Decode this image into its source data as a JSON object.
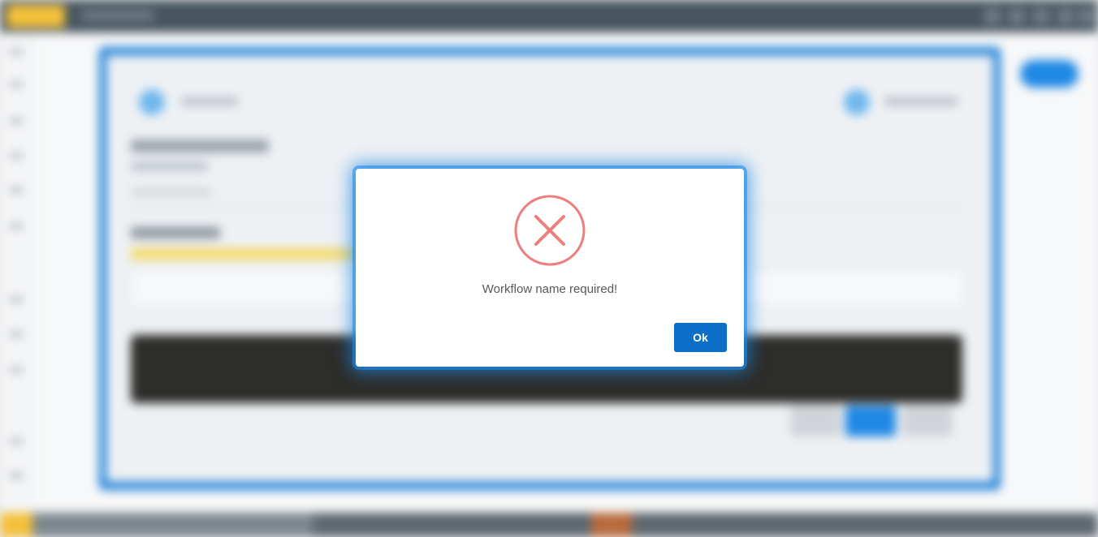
{
  "dialog": {
    "message": "Workflow name required!",
    "ok_label": "Ok",
    "icon": "error-x-icon",
    "icon_color": "#ee7d7d",
    "button_color": "#0b6fc7"
  },
  "theme": {
    "accent": "#1e88e5",
    "topbar": "#46555f",
    "logo": "#f6c23a"
  }
}
